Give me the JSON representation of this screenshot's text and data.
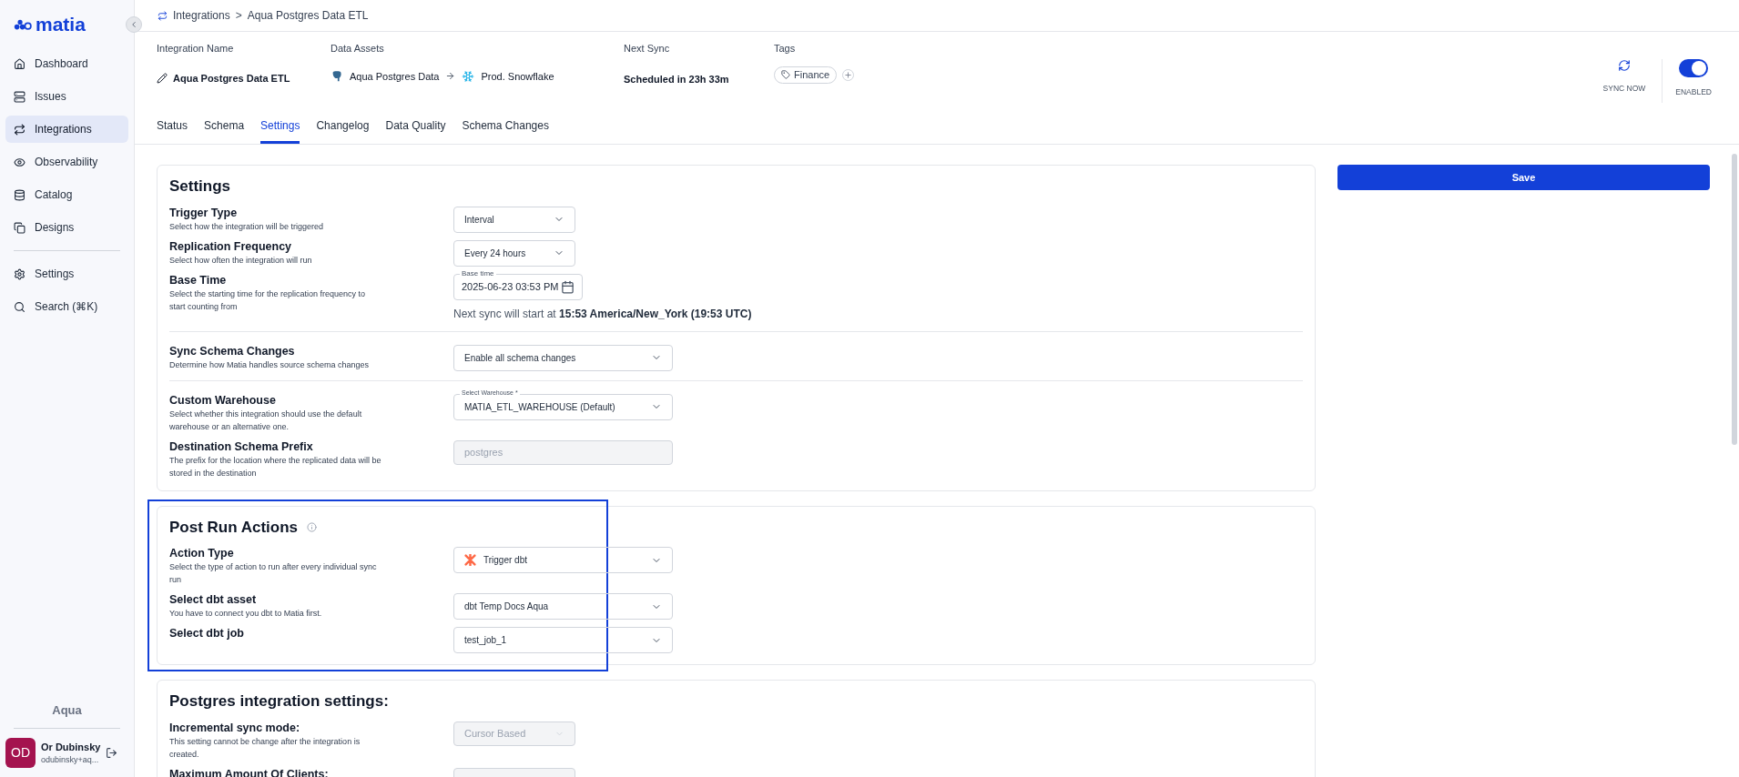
{
  "sidebar": {
    "logo": "matia",
    "items": [
      {
        "label": "Dashboard",
        "selected": false
      },
      {
        "label": "Issues",
        "selected": false
      },
      {
        "label": "Integrations",
        "selected": true
      },
      {
        "label": "Observability",
        "selected": false
      },
      {
        "label": "Catalog",
        "selected": false
      },
      {
        "label": "Designs",
        "selected": false
      }
    ],
    "bottom_items": [
      {
        "label": "Settings"
      },
      {
        "label": "Search (⌘K)"
      }
    ],
    "workspace": "Aqua",
    "user": {
      "initials": "OD",
      "name": "Or Dubinsky",
      "email": "odubinsky+aq..."
    }
  },
  "breadcrumb": {
    "items": [
      "Integrations",
      "Aqua Postgres Data ETL"
    ],
    "separator": ">"
  },
  "header": {
    "integration_name_label": "Integration Name",
    "integration_name": "Aqua Postgres Data ETL",
    "data_assets_label": "Data Assets",
    "source": "Aqua Postgres Data",
    "destination": "Prod. Snowflake",
    "next_sync_label": "Next Sync",
    "next_sync": "Scheduled in 23h 33m",
    "tags_label": "Tags",
    "tags": [
      "Finance"
    ],
    "sync_now": "SYNC NOW",
    "enabled": {
      "label": "ENABLED",
      "on": true
    }
  },
  "tabs": [
    {
      "label": "Status",
      "selected": false
    },
    {
      "label": "Schema",
      "selected": false
    },
    {
      "label": "Settings",
      "selected": true
    },
    {
      "label": "Changelog",
      "selected": false
    },
    {
      "label": "Data Quality",
      "selected": false
    },
    {
      "label": "Schema Changes",
      "selected": false
    }
  ],
  "save_button": "Save",
  "sections": [
    {
      "title": "Settings",
      "info": false,
      "highlighted": false,
      "rows": [
        {
          "label": "Trigger Type",
          "description": "Select how the integration will be triggered",
          "kind": "shortselect",
          "value": "Interval",
          "divider": false
        },
        {
          "label": "Replication Frequency",
          "description": "Select how often the integration will run",
          "kind": "shortselect",
          "value": "Every 24 hours",
          "divider": false
        },
        {
          "label": "Base Time",
          "description": "Select the starting time for the replication frequency to start counting from",
          "kind": "date",
          "floating_label": "Base time",
          "value": "2025-06-23 03:53 PM",
          "note": "Next sync will start at **15:53 America/New_York (19:53 UTC)**",
          "divider": false
        },
        {
          "label": "Sync Schema Changes",
          "description": "Determine how Matia handles source schema changes",
          "kind": "select",
          "value": "Enable all schema changes",
          "divider": true
        },
        {
          "label": "Custom Warehouse",
          "description": "Select whether this integration should use the default warehouse or an alternative one.",
          "kind": "select",
          "floating_label": "Select Warehouse *",
          "value": "MATIA_ETL_WAREHOUSE (Default)",
          "divider": true
        },
        {
          "label": "Destination Schema Prefix",
          "description": "The prefix for the location where the replicated data will be stored in the destination",
          "kind": "disabled",
          "value": "postgres",
          "divider": false
        }
      ]
    },
    {
      "title": "Post Run Actions",
      "info": true,
      "highlighted": true,
      "rows": [
        {
          "label": "Action Type",
          "description": "Select the type of action to run after every individual sync run",
          "kind": "logoselect",
          "value": "Trigger dbt",
          "divider": false
        },
        {
          "label": "Select dbt asset",
          "description": "You have to connect you dbt to Matia first.",
          "kind": "select",
          "value": "dbt Temp Docs Aqua",
          "divider": false
        },
        {
          "label": "Select dbt job",
          "kind": "select",
          "value": "test_job_1",
          "divider": false
        }
      ]
    },
    {
      "title": "Postgres integration settings:",
      "info": false,
      "highlighted": false,
      "rows": [
        {
          "label": "Incremental sync mode:",
          "description": "This setting cannot be change after the integration is created.",
          "kind": "disabledselect",
          "value": "Cursor Based",
          "divider": false
        },
        {
          "label": "Maximum Amount Of Clients:",
          "kind": "shortdisabled",
          "divider": false
        }
      ]
    }
  ]
}
